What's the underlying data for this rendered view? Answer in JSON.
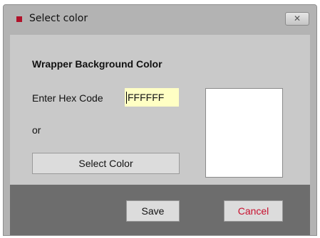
{
  "dialog": {
    "title": "Select color",
    "close_label": "✕"
  },
  "form": {
    "section_title": "Wrapper Background Color",
    "hex_label": "Enter Hex Code",
    "hex_value": "FFFFFF",
    "or_label": "or",
    "select_color_label": "Select Color",
    "preview_color": "#FFFFFF"
  },
  "footer": {
    "save_label": "Save",
    "cancel_label": "Cancel"
  },
  "colors": {
    "title_icon": "#b0122a",
    "cancel_text": "#c8102e",
    "input_bg": "#ffffc4",
    "footer_bg": "#6d6d6d"
  }
}
